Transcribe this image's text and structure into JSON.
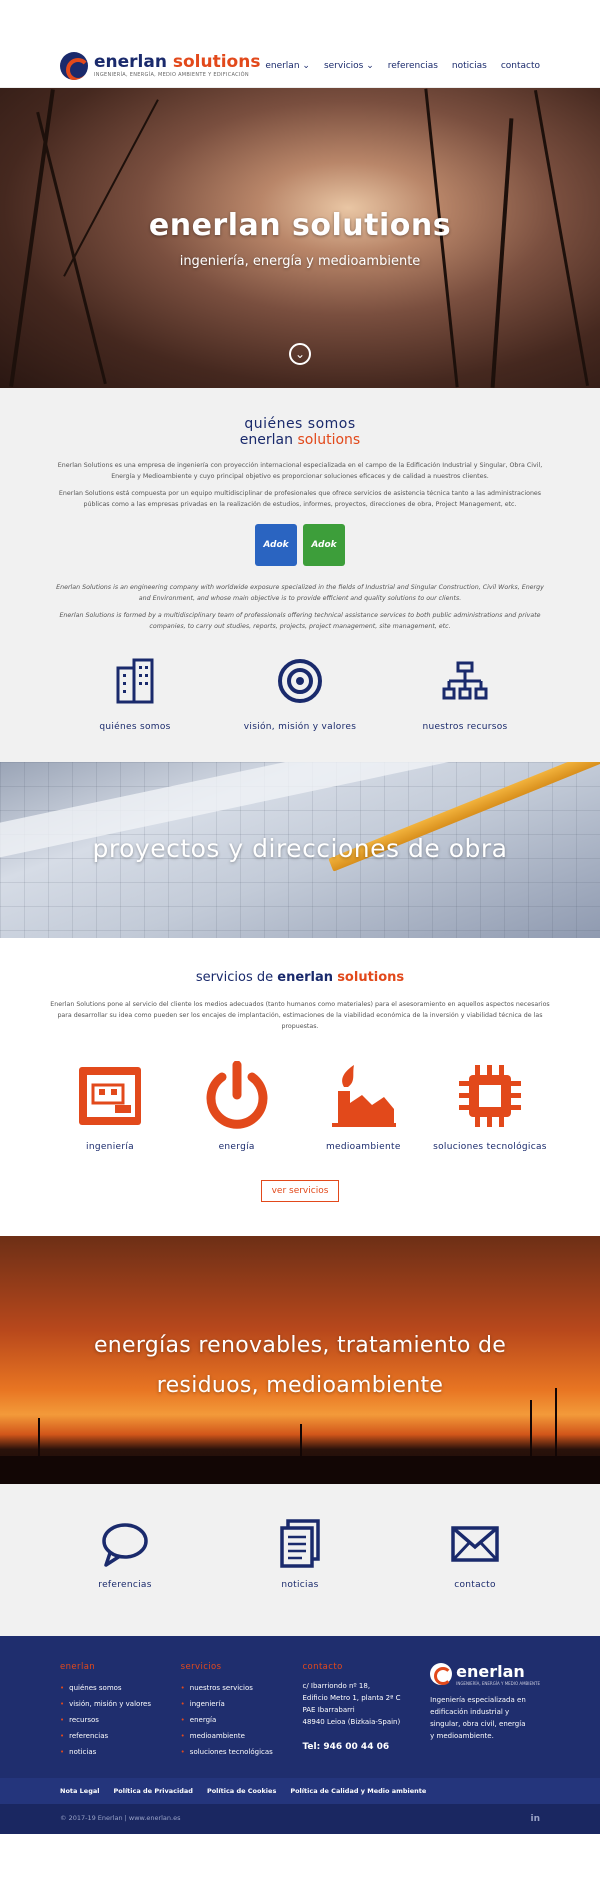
{
  "header": {
    "brand_name_1": "enerlan",
    "brand_name_2": "solutions",
    "brand_tagline": "INGENIERÍA, ENERGÍA, MEDIO AMBIENTE Y EDIFICACIÓN",
    "nav": [
      "enerlan ⌄",
      "servicios ⌄",
      "referencias",
      "noticias",
      "contacto"
    ]
  },
  "hero": {
    "title": "enerlan solutions",
    "subtitle": "ingeniería, energía y medioambiente",
    "arrow_icon": "chevron-down-icon"
  },
  "about": {
    "heading_1": "quiénes somos",
    "heading_2a": "enerlan",
    "heading_2b": "solutions",
    "p1": "Enerlan Solutions es una empresa de ingeniería con proyección internacional especializada en el campo de la Edificación Industrial y Singular, Obra Civil, Energía y Medioambiente y cuyo principal objetivo es proporcionar soluciones eficaces y de calidad a nuestros clientes.",
    "p2": "Enerlan Solutions está compuesta por un equipo multidisciplinar de profesionales que ofrece servicios de asistencia técnica tanto a las administraciones públicas como a las empresas privadas en la realización de estudios, informes, proyectos, direcciones de obra, Project Management, etc.",
    "cert_1": "Adok",
    "cert_2": "Adok",
    "p3": "Enerlan Solutions is an engineering company with worldwide exposure specialized in the fields of Industrial and Singular Construction, Civil Works, Energy and Environment, and whose main objective is to provide efficient and quality solutions to our clients.",
    "p4": "Enerlan Solutions is formed by a multidisciplinary team of professionals offering technical assistance services to both public administrations and private companies, to carry out studies, reports, projects, project management, site management, etc.",
    "features": [
      "quiénes somos",
      "visión, misión y valores",
      "nuestros recursos"
    ]
  },
  "band1": {
    "title": "proyectos y direcciones de obra"
  },
  "services": {
    "title_1": "servicios de",
    "title_2": "enerlan",
    "title_3": "solutions",
    "text": "Enerlan Solutions pone al servicio del cliente los medios adecuados (tanto humanos como materiales) para el asesoramiento en aquellos aspectos necesarios para desarrollar su idea como pueden ser los encajes de implantación, estimaciones de la viabilidad económica de la inversión y viabilidad técnica de las propuestas.",
    "items": [
      "ingeniería",
      "energía",
      "medioambiente",
      "soluciones tecnológicas"
    ],
    "button": "ver servicios"
  },
  "band2": {
    "title_line_1": "energías renovables, tratamiento de",
    "title_line_2": "residuos, medioambiente"
  },
  "cards": [
    "referencias",
    "noticias",
    "contacto"
  ],
  "footer": {
    "col1_title": "enerlan",
    "col1_items": [
      "quiénes somos",
      "visión, misión y valores",
      "recursos",
      "referencias",
      "noticias"
    ],
    "col2_title": "servicios",
    "col2_items": [
      "nuestros servicios",
      "ingeniería",
      "energía",
      "medioambiente",
      "soluciones tecnológicas"
    ],
    "col3_title": "contacto",
    "addr_1": "c/ Ibarriondo nº 18,",
    "addr_2": "Edificio Metro 1, planta 2ª C",
    "addr_3": "PAE Ibarrabarri",
    "addr_4": "48940 Leioa (Bizkaia-Spain)",
    "phone": "Tel: 946 00 44 06",
    "logo_name": "enerlan",
    "logo_tag": "INGENIERÍA, ENERGÍA Y MEDIO AMBIENTE",
    "description": "Ingeniería especializada en edificación industrial y singular, obra civil, energía y medioambiente."
  },
  "legal": [
    "Nota Legal",
    "Política de Privacidad",
    "Política de Cookies",
    "Política de Calidad y Medio ambiente"
  ],
  "copyright": "© 2017-19 Enerlan | www.enerlan.es",
  "social": "in",
  "colors": {
    "navy": "#1a2a6c",
    "accent": "#e2491b",
    "footer": "#1f2e6e"
  }
}
